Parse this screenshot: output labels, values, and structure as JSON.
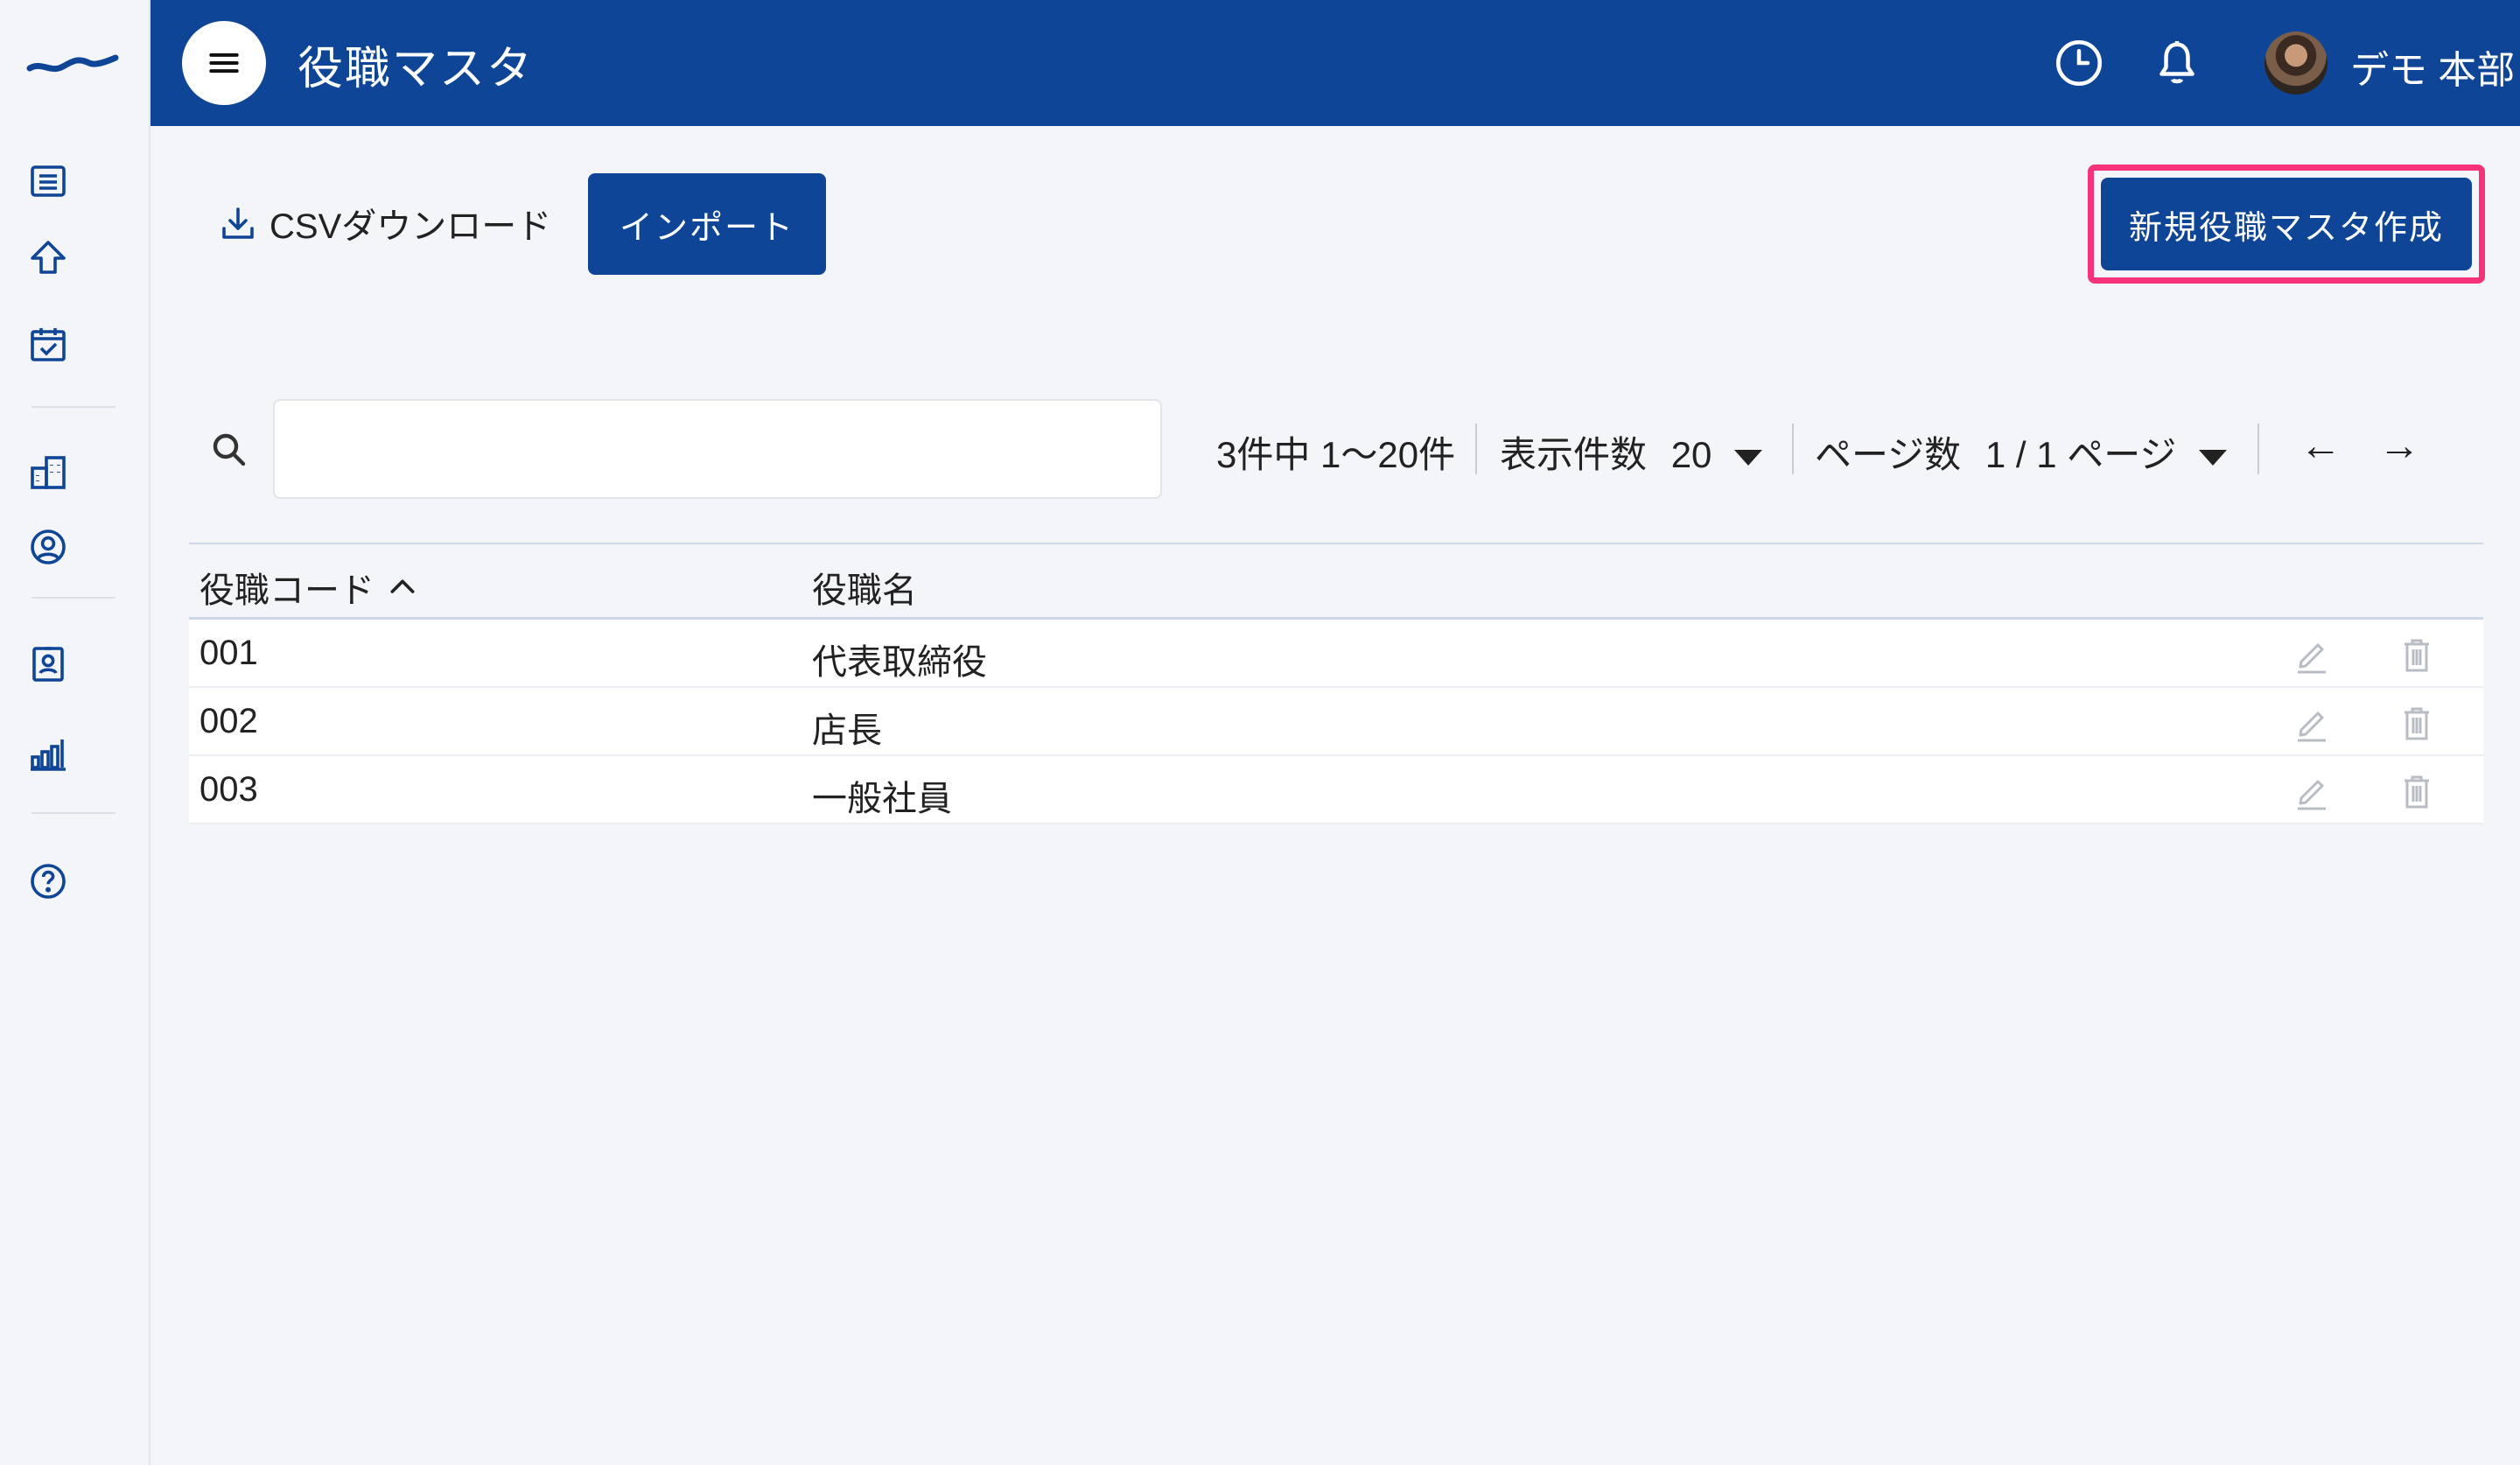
{
  "header": {
    "title": "役職マスタ",
    "user_name": "デモ 本部"
  },
  "toolbar": {
    "csv_label": "CSVダウンロード",
    "import_label": "インポート",
    "new_label": "新規役職マスタ作成"
  },
  "search": {
    "value": "",
    "placeholder": ""
  },
  "pager": {
    "count_text": "3件中 1〜20件",
    "per_page_label": "表示件数",
    "per_page_value": "20",
    "page_label": "ページ数",
    "page_value": "1 / 1 ページ",
    "prev_label": "←",
    "next_label": "→"
  },
  "table": {
    "columns": [
      "役職コード",
      "役職名"
    ],
    "rows": [
      {
        "code": "001",
        "name": "代表取締役"
      },
      {
        "code": "002",
        "name": "店長"
      },
      {
        "code": "003",
        "name": "一般社員"
      }
    ]
  },
  "colors": {
    "brand": "#0f4596",
    "highlight": "#f5327a",
    "background": "#f4f5f8"
  },
  "icons": {
    "sidebar": [
      "list-icon",
      "upload-icon",
      "calendar-check-icon",
      "building-icon",
      "user-circle-icon",
      "contact-card-icon",
      "bar-chart-icon",
      "help-icon"
    ],
    "header": [
      "menu-icon",
      "clock-icon",
      "bell-icon"
    ],
    "row_actions": [
      "edit-icon",
      "trash-icon"
    ]
  }
}
